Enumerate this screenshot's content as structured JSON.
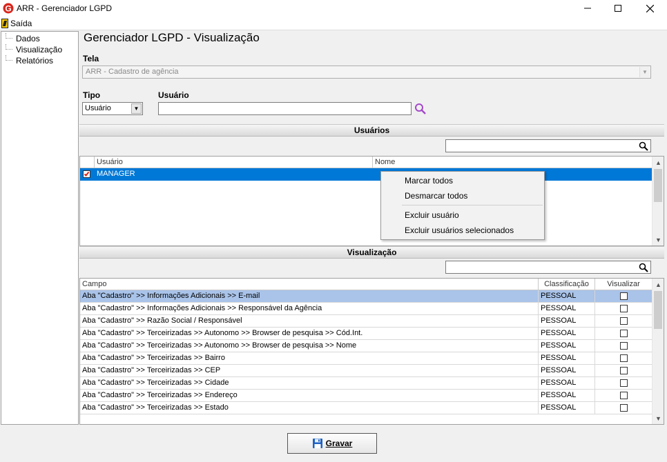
{
  "window": {
    "title": "ARR - Gerenciador LGPD",
    "logo_letter": "G"
  },
  "menu": {
    "exit_label": "Saída"
  },
  "tree": {
    "items": [
      {
        "label": "Dados"
      },
      {
        "label": "Visualização"
      },
      {
        "label": "Relatórios"
      }
    ]
  },
  "page": {
    "title": "Gerenciador LGPD - Visualização"
  },
  "form": {
    "tela_label": "Tela",
    "tela_value": "ARR - Cadastro de agência",
    "tipo_label": "Tipo",
    "tipo_value": "Usuário",
    "usuario_label": "Usuário",
    "usuario_value": ""
  },
  "users_section": {
    "title": "Usuários",
    "filter_value": "",
    "columns": [
      "Usuário",
      "Nome"
    ],
    "rows": [
      {
        "checked": true,
        "usuario": "MANAGER",
        "nome": ""
      }
    ]
  },
  "context_menu": {
    "items": [
      "Marcar todos",
      "Desmarcar todos",
      "Excluir usuário",
      "Excluir usuários selecionados"
    ]
  },
  "view_section": {
    "title": "Visualização",
    "filter_value": "",
    "columns": [
      "Campo",
      "Classificação",
      "Visualizar"
    ],
    "rows": [
      {
        "campo": "Aba \"Cadastro\" >> Informações Adicionais >> E-mail",
        "classificacao": "PESSOAL",
        "visualizar": false
      },
      {
        "campo": "Aba \"Cadastro\" >> Informações Adicionais >> Responsável da Agência",
        "classificacao": "PESSOAL",
        "visualizar": false
      },
      {
        "campo": "Aba \"Cadastro\" >> Razão Social / Responsável",
        "classificacao": "PESSOAL",
        "visualizar": false
      },
      {
        "campo": "Aba \"Cadastro\" >> Terceirizadas >> Autonomo >> Browser de pesquisa >> Cód.Int.",
        "classificacao": "PESSOAL",
        "visualizar": false
      },
      {
        "campo": "Aba \"Cadastro\" >> Terceirizadas >> Autonomo >> Browser de pesquisa >> Nome",
        "classificacao": "PESSOAL",
        "visualizar": false
      },
      {
        "campo": "Aba \"Cadastro\" >> Terceirizadas >> Bairro",
        "classificacao": "PESSOAL",
        "visualizar": false
      },
      {
        "campo": "Aba \"Cadastro\" >> Terceirizadas >> CEP",
        "classificacao": "PESSOAL",
        "visualizar": false
      },
      {
        "campo": "Aba \"Cadastro\" >> Terceirizadas >> Cidade",
        "classificacao": "PESSOAL",
        "visualizar": false
      },
      {
        "campo": "Aba \"Cadastro\" >> Terceirizadas >> Endereço",
        "classificacao": "PESSOAL",
        "visualizar": false
      },
      {
        "campo": "Aba \"Cadastro\" >> Terceirizadas >> Estado",
        "classificacao": "PESSOAL",
        "visualizar": false
      }
    ]
  },
  "footer": {
    "save_label": "Gravar"
  },
  "colors": {
    "selection_blue": "#0078d7",
    "selection_light": "#a9c3e9",
    "logo_red": "#d9261c",
    "search_purple": "#a349c9"
  }
}
